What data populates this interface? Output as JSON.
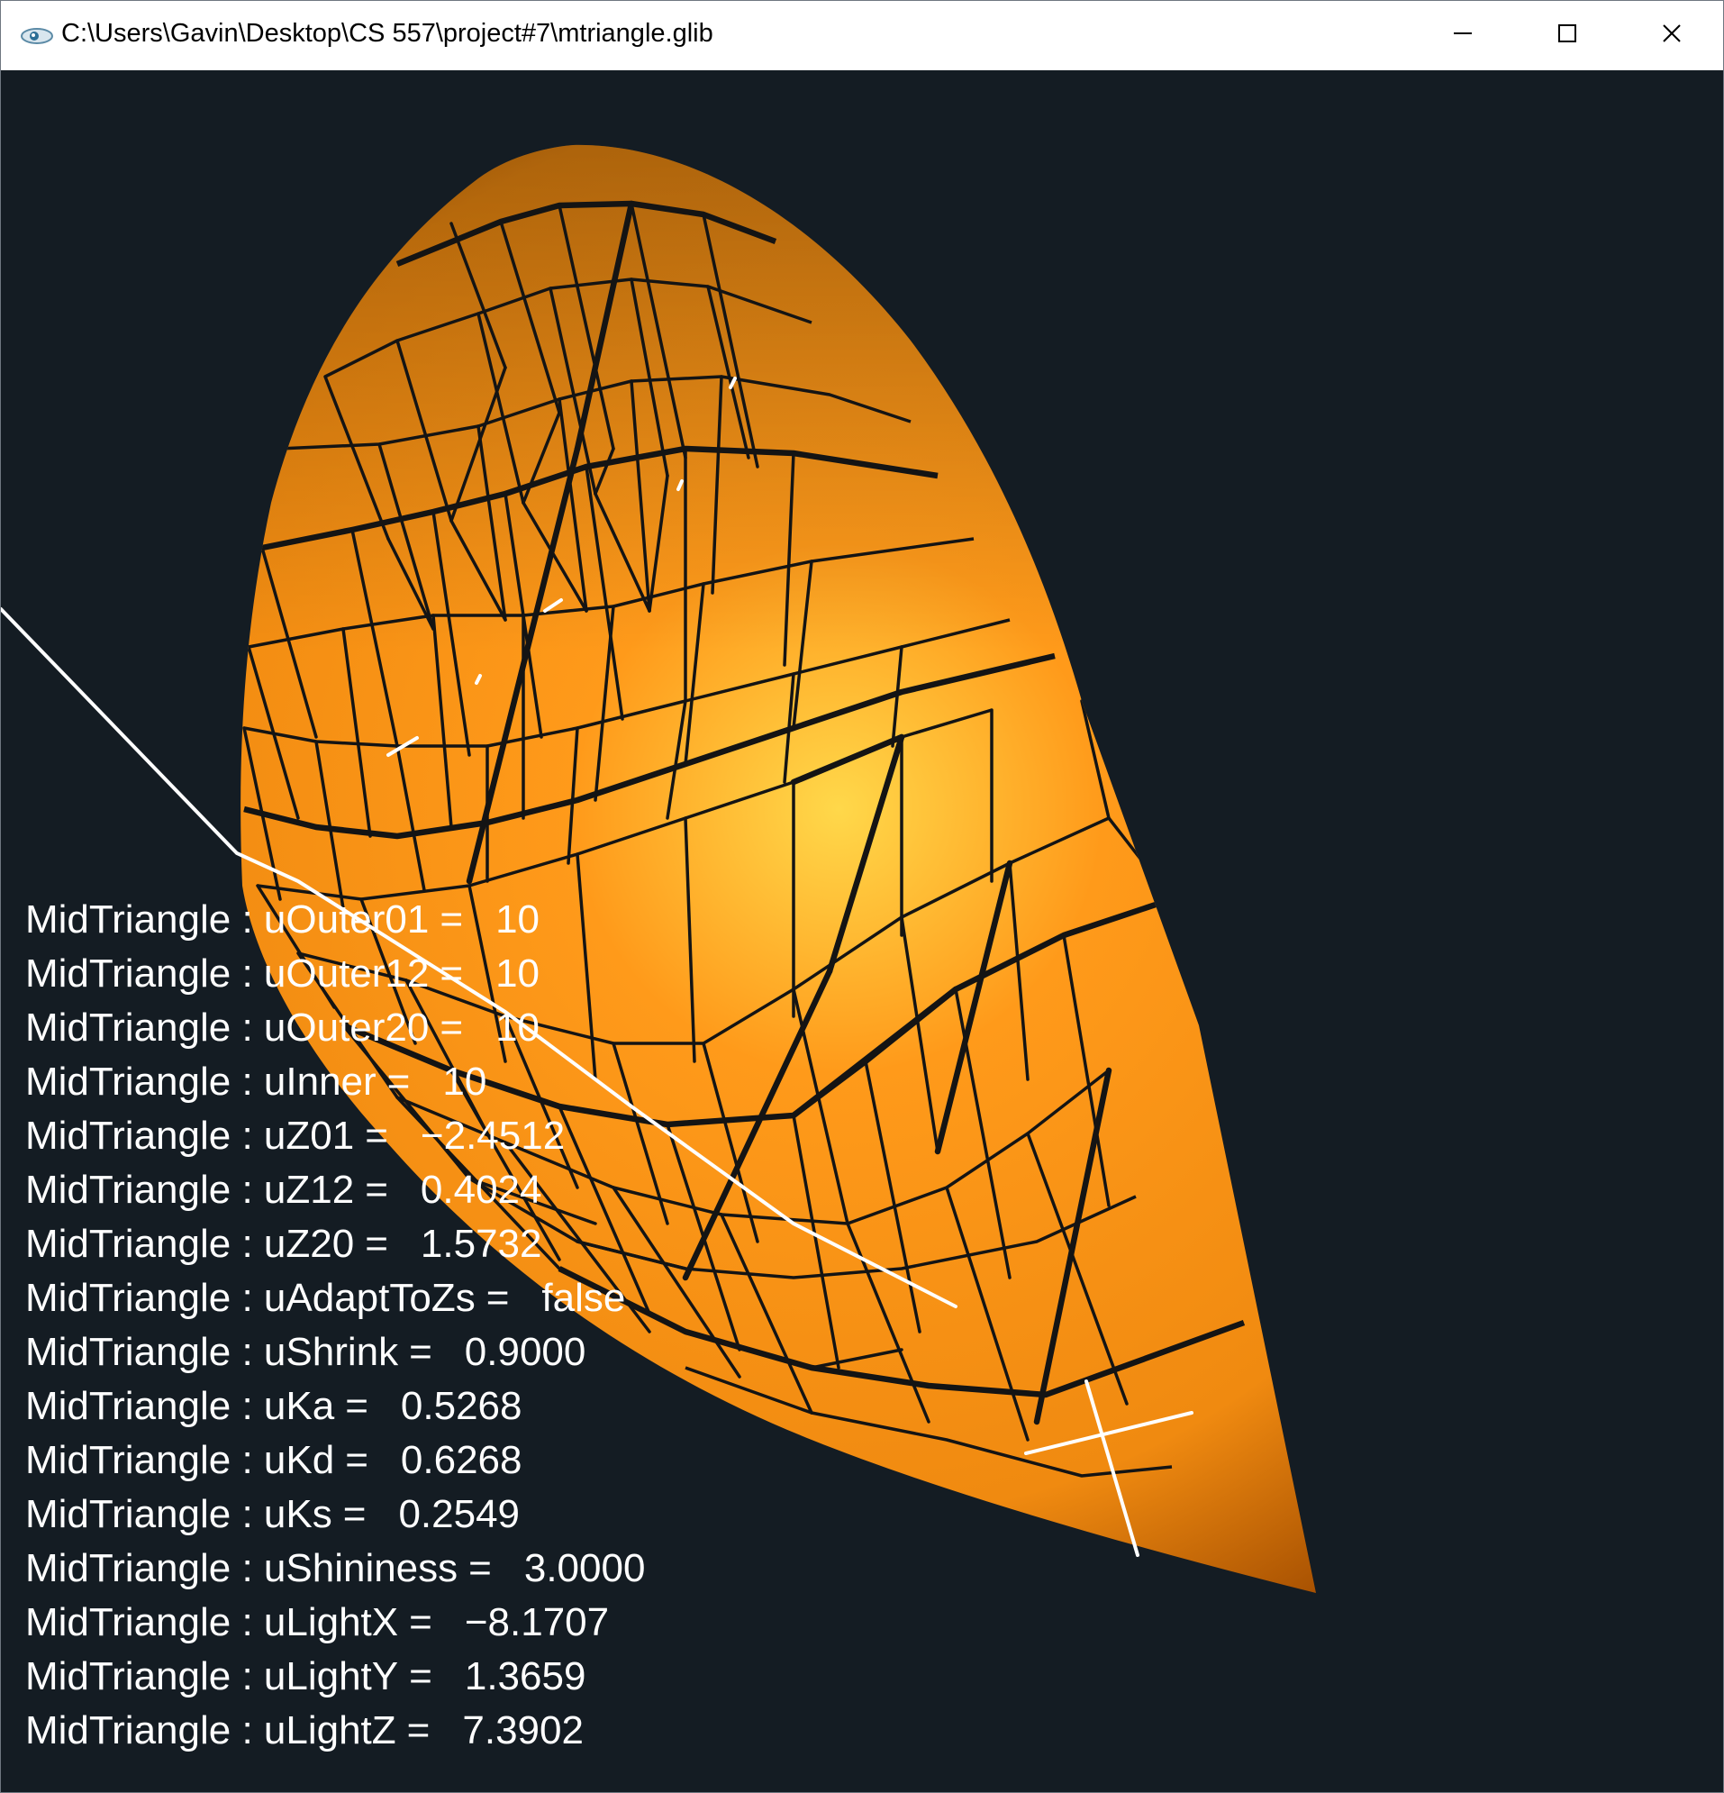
{
  "window": {
    "title": "C:\\Users\\Gavin\\Desktop\\CS 557\\project#7\\mtriangle.glib",
    "controls": {
      "minimize": "minimize-icon",
      "maximize": "maximize-icon",
      "close": "close-icon"
    }
  },
  "scene": {
    "surface_color_light": "#ffd84a",
    "surface_color_mid": "#ff9a1a",
    "surface_color_dark": "#9e4a00",
    "background_color": "#141c23",
    "wire_color": "#141414"
  },
  "uniforms": [
    {
      "label": "MidTriangle : uOuter01",
      "eq": "=",
      "value": "10"
    },
    {
      "label": "MidTriangle : uOuter12",
      "eq": "=",
      "value": "10"
    },
    {
      "label": "MidTriangle : uOuter20",
      "eq": "=",
      "value": "10"
    },
    {
      "label": "MidTriangle : uInner",
      "eq": "=",
      "value": "10"
    },
    {
      "label": "MidTriangle : uZ01",
      "eq": "=",
      "value": "−2.4512"
    },
    {
      "label": "MidTriangle : uZ12",
      "eq": "=",
      "value": "0.4024"
    },
    {
      "label": "MidTriangle : uZ20",
      "eq": "=",
      "value": "1.5732"
    },
    {
      "label": "MidTriangle : uAdaptToZs",
      "eq": "=",
      "value": "false"
    },
    {
      "label": "MidTriangle : uShrink",
      "eq": "=",
      "value": "0.9000"
    },
    {
      "label": "MidTriangle : uKa",
      "eq": "=",
      "value": "0.5268"
    },
    {
      "label": "MidTriangle : uKd",
      "eq": "=",
      "value": "0.6268"
    },
    {
      "label": "MidTriangle : uKs",
      "eq": "=",
      "value": "0.2549"
    },
    {
      "label": "MidTriangle : uShininess",
      "eq": "=",
      "value": "3.0000"
    },
    {
      "label": "MidTriangle : uLightX",
      "eq": "=",
      "value": "−8.1707"
    },
    {
      "label": "MidTriangle : uLightY",
      "eq": "=",
      "value": "1.3659"
    },
    {
      "label": "MidTriangle : uLightZ",
      "eq": "=",
      "value": "7.3902"
    }
  ]
}
